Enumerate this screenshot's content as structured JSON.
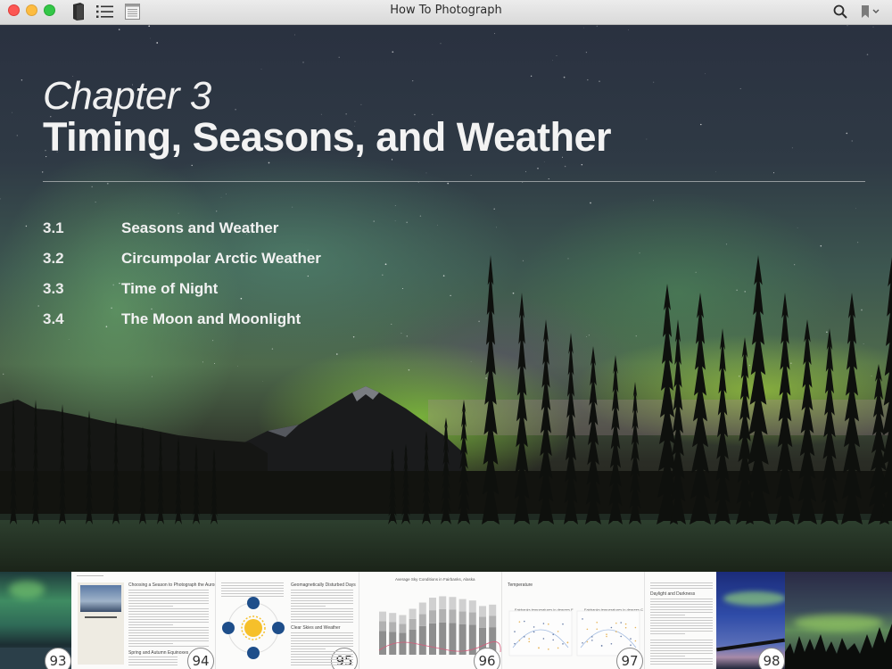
{
  "window": {
    "title": "How To Photograph",
    "toolbar_icons": [
      "library-icon",
      "table-of-contents-icon",
      "notes-icon"
    ],
    "right_icons": [
      "search-icon",
      "bookmark-icon"
    ]
  },
  "chapter": {
    "label": "Chapter 3",
    "title": "Timing, Seasons, and Weather",
    "sections": [
      {
        "number": "3.1",
        "title": "Seasons and Weather"
      },
      {
        "number": "3.2",
        "title": "Circumpolar Arctic Weather"
      },
      {
        "number": "3.3",
        "title": "Time of Night"
      },
      {
        "number": "3.4",
        "title": "The Moon and Moonlight"
      }
    ]
  },
  "thumbnails": [
    {
      "page": "93",
      "type": "photo"
    },
    {
      "page": "94",
      "type": "text",
      "heading": "Choosing a Season to Photograph the Aurora",
      "subheading": "Spring and Autumn Equinoxes"
    },
    {
      "page": "95",
      "type": "text",
      "heading": "Geomagnetically Disturbed Days",
      "subheading": "Clear Skies and Weather"
    },
    {
      "page": "96",
      "type": "chart",
      "heading": "Average Sky Conditions in Fairbanks, Alaska"
    },
    {
      "page": "97",
      "type": "chart",
      "heading": "Temperature",
      "chart_titles": [
        "Fairbanks temperatures in degrees F",
        "Fairbanks temperatures in degrees C"
      ]
    },
    {
      "page": "",
      "type": "text",
      "heading": "Daylight and Darkness"
    },
    {
      "page": "98",
      "type": "photo"
    }
  ],
  "colors": {
    "close": "#fc5753",
    "minimize": "#fdbc40",
    "maximize": "#33c748",
    "aurora_green": "#8fd24a"
  }
}
